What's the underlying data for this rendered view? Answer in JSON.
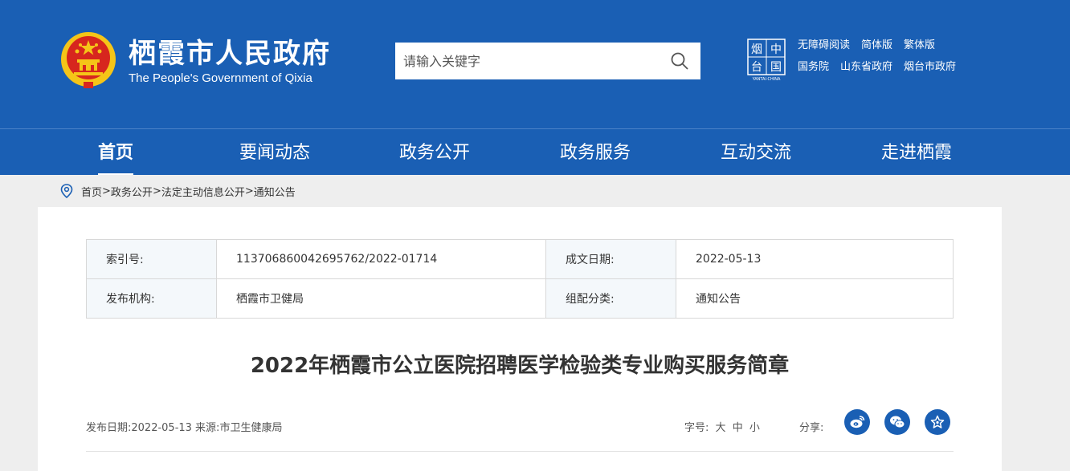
{
  "header": {
    "title_cn": "栖霞市人民政府",
    "title_en": "The People's Government of Qixia",
    "search_placeholder": "请输入关键字",
    "links_row1": [
      "无障碍阅读",
      "简体版",
      "繁体版"
    ],
    "links_row2": [
      "国务院",
      "山东省政府",
      "烟台市政府"
    ],
    "logo_text": "烟台中国",
    "logo_caption": "YANTAI·CHINA"
  },
  "nav": {
    "items": [
      "首页",
      "要闻动态",
      "政务公开",
      "政务服务",
      "互动交流",
      "走进栖霞"
    ],
    "active_index": 0
  },
  "breadcrumb": [
    "首页",
    "政务公开",
    "法定主动信息公开",
    "通知公告"
  ],
  "meta": {
    "index_label": "索引号:",
    "index_value": "113706860042695762/2022-01714",
    "date_label": "成文日期:",
    "date_value": "2022-05-13",
    "org_label": "发布机构:",
    "org_value": "栖霞市卫健局",
    "category_label": "组配分类:",
    "category_value": "通知公告"
  },
  "article": {
    "title": "2022年栖霞市公立医院招聘医学检验类专业购买服务简章",
    "pub_info": "发布日期:2022-05-13 来源:市卫生健康局",
    "fontsize_label": "字号:",
    "fontsize_options": [
      "大",
      "中",
      "小"
    ],
    "share_label": "分享:"
  },
  "colors": {
    "brand_blue": "#1a5fb4",
    "emblem_red": "#d7261e",
    "emblem_gold": "#f5c518"
  }
}
